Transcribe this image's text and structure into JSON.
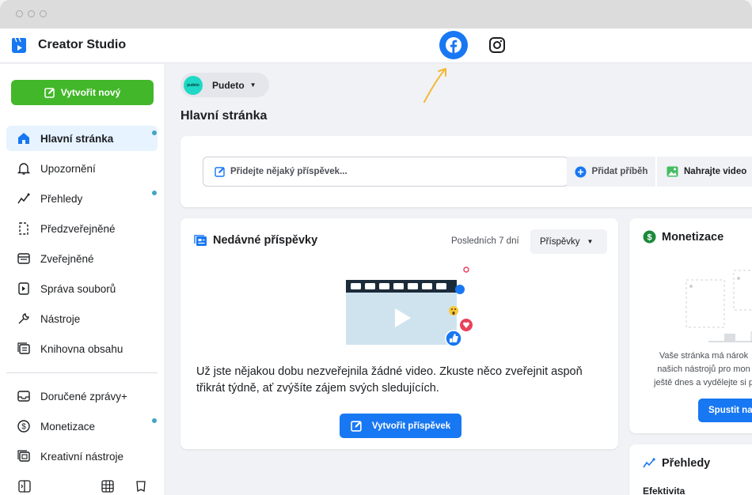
{
  "window": {
    "controls": [
      "close",
      "minimize",
      "maximize"
    ]
  },
  "header": {
    "brand": "Creator Studio",
    "logo_icon": "creator-studio-logo-icon",
    "platforms": [
      {
        "name": "facebook-icon",
        "active": true
      },
      {
        "name": "instagram-icon",
        "active": false
      }
    ]
  },
  "colors": {
    "accent": "#1877f2",
    "create": "#42b72a",
    "active_bg": "#e7f3ff",
    "notification_dot": "#42a5c6",
    "arrow": "#f5b833"
  },
  "sidebar": {
    "create_label": "Vytvořit nový",
    "items": [
      {
        "label": "Hlavní stránka",
        "icon": "home-icon",
        "active": true,
        "dot": true
      },
      {
        "label": "Upozornění",
        "icon": "bell-icon",
        "active": false,
        "dot": false
      },
      {
        "label": "Přehledy",
        "icon": "insights-icon",
        "active": false,
        "dot": true
      },
      {
        "label": "Předzveřejněné",
        "icon": "draft-icon",
        "active": false,
        "dot": false
      },
      {
        "label": "Zveřejněné",
        "icon": "published-icon",
        "active": false,
        "dot": false
      },
      {
        "label": "Správa souborů",
        "icon": "file-icon",
        "active": false,
        "dot": false
      },
      {
        "label": "Nástroje",
        "icon": "wrench-icon",
        "active": false,
        "dot": false
      },
      {
        "label": "Knihovna obsahu",
        "icon": "library-icon",
        "active": false,
        "dot": false
      },
      {
        "label": "Doručené zprávy+",
        "icon": "inbox-icon",
        "active": false,
        "dot": false
      },
      {
        "label": "Monetizace",
        "icon": "dollar-icon",
        "active": false,
        "dot": true
      },
      {
        "label": "Kreativní nástroje",
        "icon": "creative-tools-icon",
        "active": false,
        "dot": false
      }
    ]
  },
  "main": {
    "page_selector": {
      "avatar_text": "pudeto",
      "name": "Pudeto"
    },
    "title": "Hlavní stránka",
    "composer": {
      "placeholder": "Přidejte nějaký příspěvek...",
      "add_story": "Přidat příběh",
      "upload_video": "Nahrajte video"
    },
    "recent": {
      "title": "Nedávné příspěvky",
      "period": "Posledních 7 dní",
      "filter": "Příspěvky",
      "message": "Už jste nějakou dobu nezveřejnila žádné video. Zkuste něco zveřejnit aspoň třikrát týdně, ať zvýšíte zájem svých sledujících.",
      "cta": "Vytvořit příspěvek"
    },
    "monetization": {
      "title": "Monetizace",
      "text_lines": [
        "Vaše stránka má nárok",
        "našich nástrojů pro mon",
        "ještě dnes a vydělejte si p"
      ],
      "button": "Spustit na"
    },
    "insights": {
      "title": "Přehledy",
      "subtitle": "Efektivita"
    }
  }
}
